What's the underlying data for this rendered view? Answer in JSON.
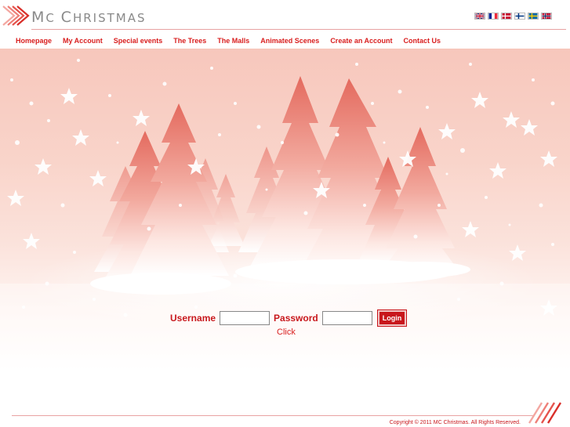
{
  "brand": {
    "name_initial_1": "M",
    "name_rest_1": "C ",
    "name_initial_2": "C",
    "name_rest_2": "HRISTMAS"
  },
  "languages": [
    {
      "icon": "flag-uk-icon",
      "colors": [
        "#012169",
        "#ffffff",
        "#c8102e"
      ]
    },
    {
      "icon": "flag-fr-icon",
      "colors": [
        "#002395",
        "#ffffff",
        "#ed2939"
      ]
    },
    {
      "icon": "flag-dk-icon",
      "colors": [
        "#c60c30",
        "#ffffff"
      ]
    },
    {
      "icon": "flag-fi-icon",
      "colors": [
        "#ffffff",
        "#003580"
      ]
    },
    {
      "icon": "flag-se-icon",
      "colors": [
        "#006aa7",
        "#fecc00"
      ]
    },
    {
      "icon": "flag-no-icon",
      "colors": [
        "#ba0c2f",
        "#ffffff",
        "#00205b"
      ]
    }
  ],
  "nav": {
    "items": [
      {
        "label": "Homepage"
      },
      {
        "label": "My Account"
      },
      {
        "label": "Special events"
      },
      {
        "label": "The Trees"
      },
      {
        "label": "The Malls"
      },
      {
        "label": "Animated Scenes"
      },
      {
        "label": "Create an Account"
      },
      {
        "label": "Contact Us"
      }
    ]
  },
  "hero": {
    "click_text": "Click"
  },
  "login": {
    "username_label": "Username",
    "password_label": "Password",
    "username_value": "",
    "password_value": "",
    "button_label": "Login"
  },
  "footer": {
    "copyright": "Copyright © 2011  MC Christmas. All Rights Reserved."
  },
  "colors": {
    "accent": "#d91e1e",
    "button": "#c8161b",
    "rule": "#e8a2a2",
    "logo_text": "#8a8a8a"
  }
}
